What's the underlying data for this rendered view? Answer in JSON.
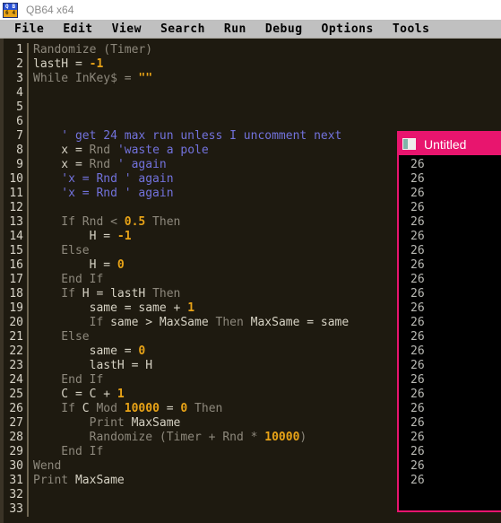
{
  "window": {
    "app_title": "QB64 x64",
    "logo": {
      "q": "Q",
      "b": "B",
      "six": "6",
      "four": "4"
    }
  },
  "menubar": {
    "items": [
      {
        "label": "File",
        "name": "menu-file"
      },
      {
        "label": "Edit",
        "name": "menu-edit"
      },
      {
        "label": "View",
        "name": "menu-view"
      },
      {
        "label": "Search",
        "name": "menu-search"
      },
      {
        "label": "Run",
        "name": "menu-run"
      },
      {
        "label": "Debug",
        "name": "menu-debug"
      },
      {
        "label": "Options",
        "name": "menu-options"
      },
      {
        "label": "Tools",
        "name": "menu-tools"
      }
    ]
  },
  "editor": {
    "lines": [
      {
        "n": "1",
        "tokens": [
          {
            "t": "Randomize (Timer)",
            "c": "kw"
          }
        ]
      },
      {
        "n": "2",
        "tokens": [
          {
            "t": "lastH = ",
            "c": "id"
          },
          {
            "t": "-1",
            "c": "num"
          }
        ]
      },
      {
        "n": "3",
        "tokens": [
          {
            "t": "While InKey$ = ",
            "c": "kw"
          },
          {
            "t": "\"\"",
            "c": "str"
          }
        ]
      },
      {
        "n": "4",
        "tokens": []
      },
      {
        "n": "5",
        "tokens": []
      },
      {
        "n": "6",
        "tokens": []
      },
      {
        "n": "7",
        "tokens": [
          {
            "t": "    ' get 24 max run unless I uncomment next",
            "c": "cmt"
          }
        ]
      },
      {
        "n": "8",
        "tokens": [
          {
            "t": "    x = ",
            "c": "id"
          },
          {
            "t": "Rnd ",
            "c": "kw"
          },
          {
            "t": "'waste a pole",
            "c": "cmt"
          }
        ]
      },
      {
        "n": "9",
        "tokens": [
          {
            "t": "    x = ",
            "c": "id"
          },
          {
            "t": "Rnd ",
            "c": "kw"
          },
          {
            "t": "' again",
            "c": "cmt"
          }
        ]
      },
      {
        "n": "10",
        "tokens": [
          {
            "t": "    'x = Rnd ' again",
            "c": "cmt"
          }
        ]
      },
      {
        "n": "11",
        "tokens": [
          {
            "t": "    'x = Rnd ' again",
            "c": "cmt"
          }
        ]
      },
      {
        "n": "12",
        "tokens": []
      },
      {
        "n": "13",
        "tokens": [
          {
            "t": "    If Rnd < ",
            "c": "kw"
          },
          {
            "t": "0.5",
            "c": "num"
          },
          {
            "t": " Then",
            "c": "kw"
          }
        ]
      },
      {
        "n": "14",
        "tokens": [
          {
            "t": "        H = ",
            "c": "id"
          },
          {
            "t": "-1",
            "c": "num"
          }
        ]
      },
      {
        "n": "15",
        "tokens": [
          {
            "t": "    Else",
            "c": "kw"
          }
        ]
      },
      {
        "n": "16",
        "tokens": [
          {
            "t": "        H = ",
            "c": "id"
          },
          {
            "t": "0",
            "c": "num"
          }
        ]
      },
      {
        "n": "17",
        "tokens": [
          {
            "t": "    End If",
            "c": "kw"
          }
        ]
      },
      {
        "n": "18",
        "tokens": [
          {
            "t": "    If ",
            "c": "kw"
          },
          {
            "t": "H = lastH",
            "c": "id"
          },
          {
            "t": " Then",
            "c": "kw"
          }
        ]
      },
      {
        "n": "19",
        "tokens": [
          {
            "t": "        same = same + ",
            "c": "id"
          },
          {
            "t": "1",
            "c": "num"
          }
        ]
      },
      {
        "n": "20",
        "tokens": [
          {
            "t": "        If ",
            "c": "kw"
          },
          {
            "t": "same > MaxSame",
            "c": "id"
          },
          {
            "t": " Then ",
            "c": "kw"
          },
          {
            "t": "MaxSame = same",
            "c": "id"
          }
        ]
      },
      {
        "n": "21",
        "tokens": [
          {
            "t": "    Else",
            "c": "kw"
          }
        ]
      },
      {
        "n": "22",
        "tokens": [
          {
            "t": "        same = ",
            "c": "id"
          },
          {
            "t": "0",
            "c": "num"
          }
        ]
      },
      {
        "n": "23",
        "tokens": [
          {
            "t": "        lastH = H",
            "c": "id"
          }
        ]
      },
      {
        "n": "24",
        "tokens": [
          {
            "t": "    End If",
            "c": "kw"
          }
        ]
      },
      {
        "n": "25",
        "tokens": [
          {
            "t": "    C = C + ",
            "c": "id"
          },
          {
            "t": "1",
            "c": "num"
          }
        ]
      },
      {
        "n": "26",
        "tokens": [
          {
            "t": "    If ",
            "c": "kw"
          },
          {
            "t": "C ",
            "c": "id"
          },
          {
            "t": "Mod ",
            "c": "kw"
          },
          {
            "t": "10000",
            "c": "num"
          },
          {
            "t": " = ",
            "c": "id"
          },
          {
            "t": "0",
            "c": "num"
          },
          {
            "t": " Then",
            "c": "kw"
          }
        ]
      },
      {
        "n": "27",
        "tokens": [
          {
            "t": "        Print ",
            "c": "kw"
          },
          {
            "t": "MaxSame",
            "c": "id"
          }
        ]
      },
      {
        "n": "28",
        "tokens": [
          {
            "t": "        Randomize (Timer + Rnd * ",
            "c": "kw"
          },
          {
            "t": "10000",
            "c": "num"
          },
          {
            "t": ")",
            "c": "kw"
          }
        ]
      },
      {
        "n": "29",
        "tokens": [
          {
            "t": "    End If",
            "c": "kw"
          }
        ]
      },
      {
        "n": "30",
        "tokens": [
          {
            "t": "Wend",
            "c": "kw"
          }
        ]
      },
      {
        "n": "31",
        "tokens": [
          {
            "t": "Print ",
            "c": "kw"
          },
          {
            "t": "MaxSame",
            "c": "id"
          }
        ]
      },
      {
        "n": "32",
        "tokens": []
      },
      {
        "n": "33",
        "tokens": []
      }
    ]
  },
  "output_window": {
    "title": "Untitled",
    "lines": [
      "26",
      "26",
      "26",
      "26",
      "26",
      "26",
      "26",
      "26",
      "26",
      "26",
      "26",
      "26",
      "26",
      "26",
      "26",
      "26",
      "26",
      "26",
      "26",
      "26",
      "26",
      "26",
      "26"
    ]
  },
  "colors": {
    "accent_pink": "#e8156e",
    "menubar_gray": "#c0c0c0",
    "editor_bg": "#1e1a10",
    "keyword": "#8d887c",
    "identifier": "#d6d2c4",
    "number": "#e8a317",
    "comment": "#7272dc",
    "output_text": "#b9b9b4"
  }
}
